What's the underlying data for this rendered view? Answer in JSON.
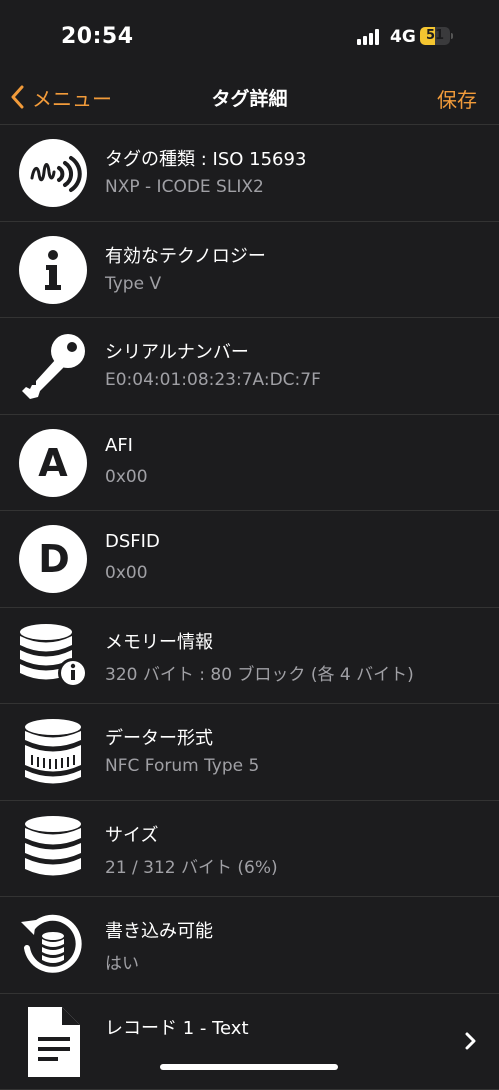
{
  "status": {
    "time": "20:54",
    "network": "4G",
    "battery": "51",
    "battery_level": 0.51
  },
  "nav": {
    "back_label": "メニュー",
    "title": "タグ詳細",
    "save_label": "保存"
  },
  "rows": [
    {
      "title": "タグの種類 : ISO 15693",
      "value": "NXP - ICODE SLIX2",
      "icon": "nfc-tag-icon"
    },
    {
      "title": "有効なテクノロジー",
      "value": "Type V",
      "icon": "info-icon"
    },
    {
      "title": "シリアルナンバー",
      "value": "E0:04:01:08:23:7A:DC:7F",
      "icon": "key-icon"
    },
    {
      "title": "AFI",
      "value": "0x00",
      "icon": "letter-a-icon",
      "glyph": "A"
    },
    {
      "title": "DSFID",
      "value": "0x00",
      "icon": "letter-d-icon",
      "glyph": "D"
    },
    {
      "title": "メモリー情報",
      "value": "320 バイト : 80 ブロック (各 4 バイト)",
      "icon": "database-info-icon"
    },
    {
      "title": "データー形式",
      "value": "NFC Forum Type 5",
      "icon": "database-format-icon"
    },
    {
      "title": "サイズ",
      "value": "21 / 312 バイト (6%)",
      "icon": "database-icon"
    },
    {
      "title": "書き込み可能",
      "value": "はい",
      "icon": "writable-icon"
    },
    {
      "title": "レコード 1 - Text",
      "value": "",
      "icon": "document-icon"
    }
  ]
}
